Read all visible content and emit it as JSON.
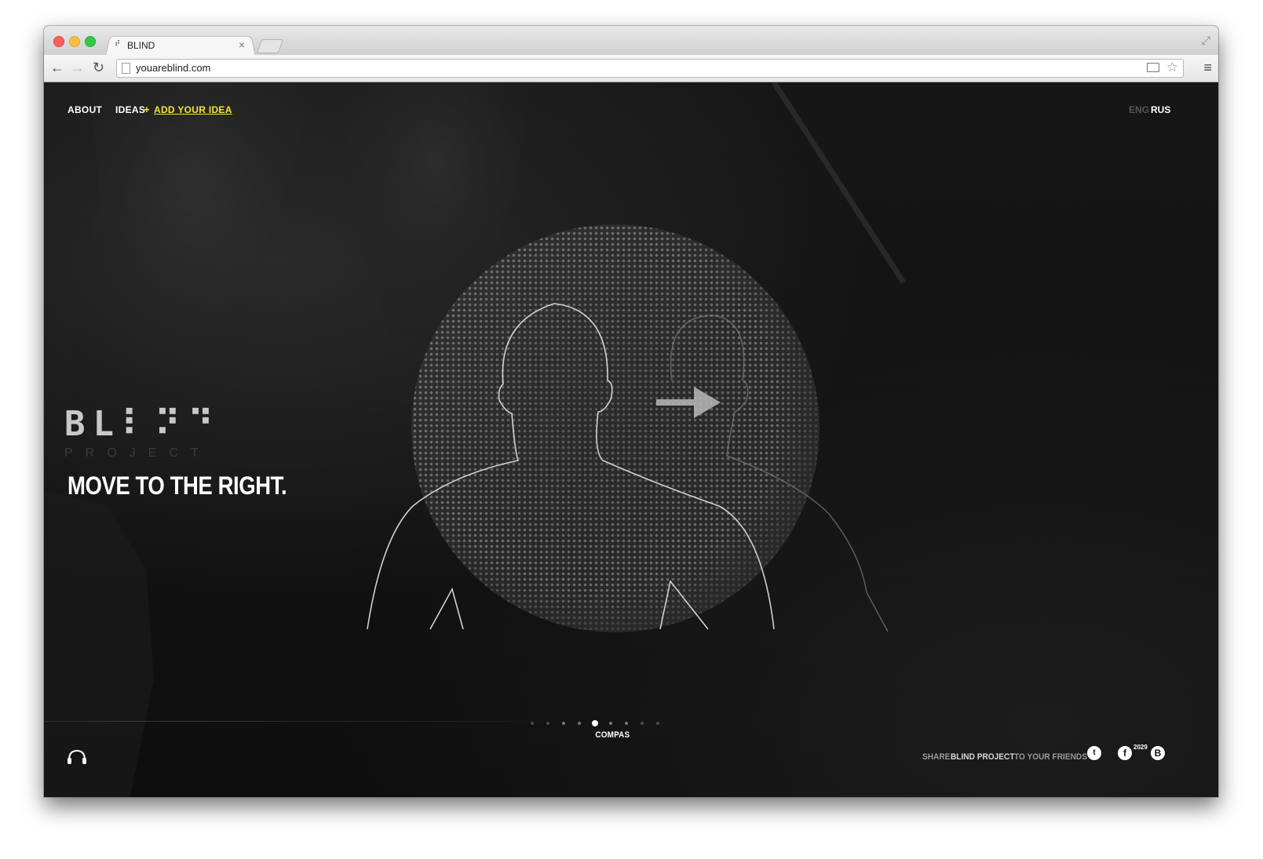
{
  "browser": {
    "tab_title": "BLIND",
    "tab_favicon": "⠞",
    "tab_close": "×",
    "url": "youareblind.com",
    "back_icon": "←",
    "forward_icon": "→",
    "reload_icon": "↻",
    "star_icon": "☆",
    "menu_icon": "≡",
    "fullscreen_icon": "⤢"
  },
  "nav": {
    "about": "ABOUT",
    "ideas": "IDEAS",
    "plus": "+",
    "add_idea": "ADD YOUR IDEA"
  },
  "lang": {
    "eng": "ENG",
    "rus": "RUS"
  },
  "logo": {
    "main": "BL⠇⠝⠙",
    "sub": "PROJECT"
  },
  "headline": "MOVE TO THE RIGHT.",
  "pager": {
    "label": "COMPAS",
    "dots": 9,
    "active_index": 4
  },
  "share": {
    "prefix": "SHARE",
    "project": "BLIND PROJECT",
    "suffix": "TO YOUR FRIENDS",
    "twitter_glyph": "t",
    "facebook_glyph": "f",
    "facebook_count": "2029",
    "vk_glyph": "B"
  },
  "colors": {
    "accent": "#f3e53b",
    "background": "#111111",
    "text": "#ffffff"
  }
}
